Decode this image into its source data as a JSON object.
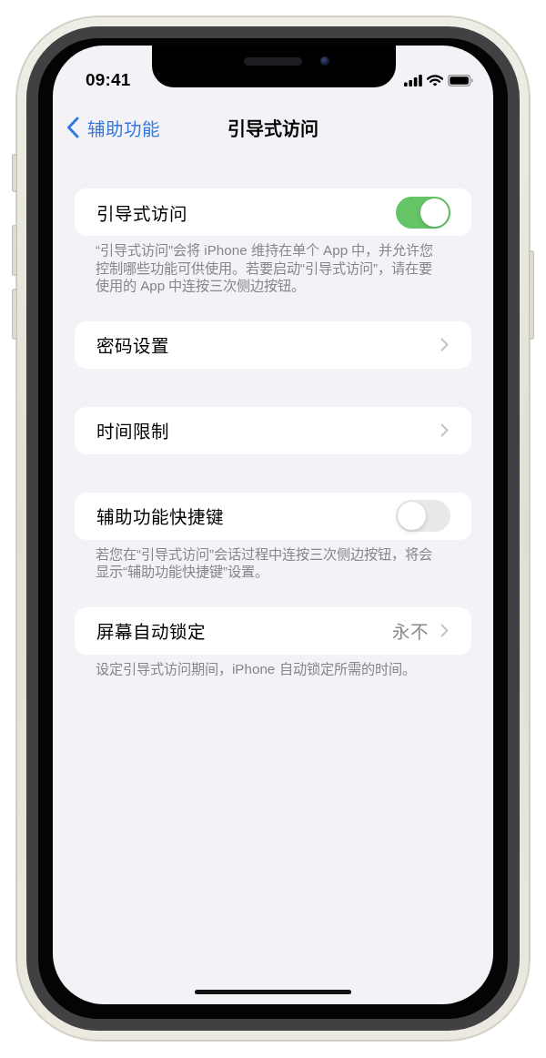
{
  "status_bar": {
    "time": "09:41"
  },
  "nav_bar": {
    "back": {
      "label": "辅助功能"
    },
    "title": "引导式访问"
  },
  "groups": [
    {
      "rows": [
        {
          "kind": "toggle",
          "label": "引导式访问",
          "on": true
        }
      ],
      "footer": "“引导式访问”会将 iPhone 维持在单个 App 中，并允许您控制哪些功能可供使用。若要启动“引导式访问”，请在要使用的 App 中连按三次侧边按钮。"
    },
    {
      "rows": [
        {
          "kind": "link",
          "label": "密码设置"
        }
      ]
    },
    {
      "rows": [
        {
          "kind": "link",
          "label": "时间限制"
        }
      ]
    },
    {
      "rows": [
        {
          "kind": "toggle",
          "label": "辅助功能快捷键",
          "on": false
        }
      ],
      "footer": "若您在“引导式访问”会话过程中连按三次侧边按钮，将会显示“辅助功能快捷键”设置。"
    },
    {
      "rows": [
        {
          "kind": "link",
          "label": "屏幕自动锁定",
          "value": "永不"
        }
      ],
      "footer": "设定引导式访问期间，iPhone 自动锁定所需的时间。"
    }
  ]
}
